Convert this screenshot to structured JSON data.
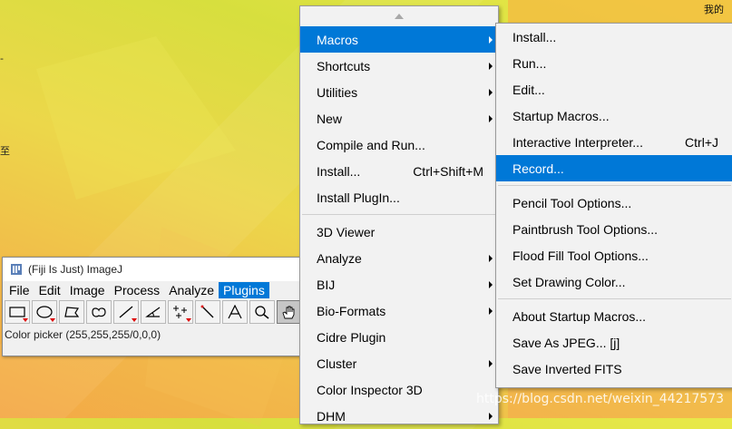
{
  "desktop": {
    "corner_text": "我的",
    "edge_glyphs": [
      "-",
      "至"
    ]
  },
  "imagej": {
    "title": "(Fiji Is Just) ImageJ",
    "menubar": [
      "File",
      "Edit",
      "Image",
      "Process",
      "Analyze",
      "Plugins"
    ],
    "active_menu": "Plugins",
    "tools": [
      "rectangle-tool",
      "oval-tool",
      "polygon-tool",
      "freehand-tool",
      "line-tool",
      "angle-tool",
      "multipoint-tool",
      "wand-tool",
      "text-tool",
      "magnifier-tool",
      "hand-tool"
    ],
    "status": "Color picker (255,255,255/0,0,0)"
  },
  "plugins_menu": {
    "items": [
      {
        "label": "Macros",
        "submenu": true,
        "highlighted": true
      },
      {
        "label": "Shortcuts",
        "submenu": true
      },
      {
        "label": "Utilities",
        "submenu": true
      },
      {
        "label": "New",
        "submenu": true
      },
      {
        "label": "Compile and Run..."
      },
      {
        "label": "Install...",
        "shortcut": "Ctrl+Shift+M"
      },
      {
        "label": "Install PlugIn..."
      },
      {
        "separator": true
      },
      {
        "label": "3D Viewer"
      },
      {
        "label": "Analyze",
        "submenu": true
      },
      {
        "label": "BIJ",
        "submenu": true
      },
      {
        "label": "Bio-Formats",
        "submenu": true
      },
      {
        "label": "Cidre Plugin"
      },
      {
        "label": "Cluster",
        "submenu": true
      },
      {
        "label": "Color Inspector 3D"
      },
      {
        "label": "DHM",
        "submenu": true
      }
    ]
  },
  "macros_menu": {
    "items": [
      {
        "label": "Install..."
      },
      {
        "label": "Run..."
      },
      {
        "label": "Edit..."
      },
      {
        "label": "Startup Macros..."
      },
      {
        "label": "Interactive Interpreter...",
        "shortcut": "Ctrl+J"
      },
      {
        "label": "Record...",
        "highlighted": true
      },
      {
        "separator": true
      },
      {
        "label": "Pencil Tool Options..."
      },
      {
        "label": "Paintbrush Tool Options..."
      },
      {
        "label": "Flood Fill Tool Options..."
      },
      {
        "label": "Set Drawing Color..."
      },
      {
        "separator": true
      },
      {
        "label": "About Startup Macros..."
      },
      {
        "label": "Save As JPEG... [j]"
      },
      {
        "label": "Save Inverted FITS"
      }
    ]
  },
  "watermark": "https://blog.csdn.net/weixin_44217573",
  "colors": {
    "highlight": "#0078d7",
    "menu_bg": "#f2f2f2"
  }
}
